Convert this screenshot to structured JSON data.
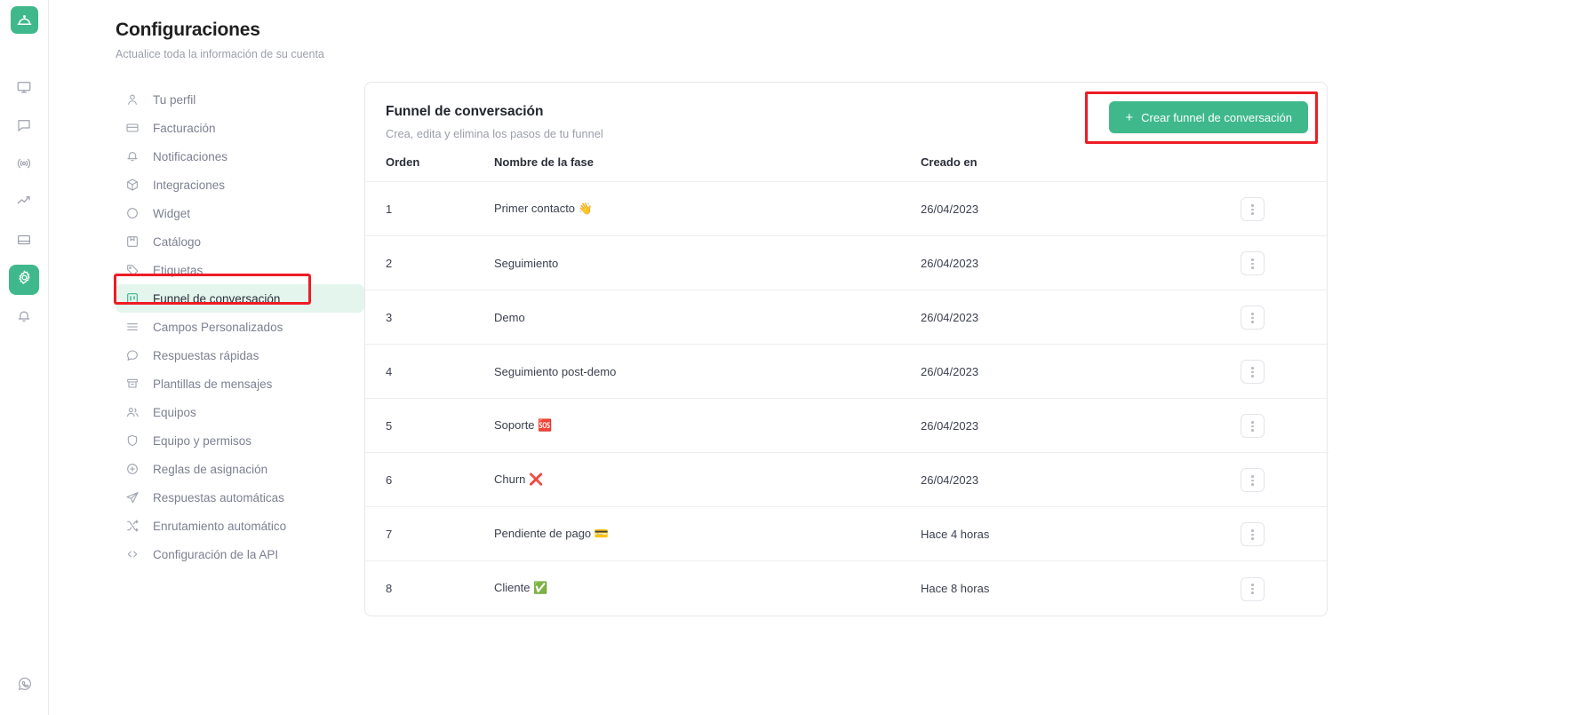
{
  "brand": {
    "accent": "#3fb98c",
    "accent_soft": "#e4f5ee",
    "annotation": "#ee1c25",
    "logo_icon": "cloche-bell-icon"
  },
  "rail": {
    "items": [
      {
        "icon": "monitor-icon",
        "name": "rail-monitor",
        "active": false
      },
      {
        "icon": "chat-bubble-icon",
        "name": "rail-conversations",
        "active": false
      },
      {
        "icon": "broadcast-icon",
        "name": "rail-campaigns",
        "active": false
      },
      {
        "icon": "trending-up-icon",
        "name": "rail-reports",
        "active": false
      },
      {
        "icon": "inbox-icon",
        "name": "rail-inbox",
        "active": false
      },
      {
        "icon": "gear-icon",
        "name": "rail-settings",
        "active": true
      },
      {
        "icon": "bell-icon",
        "name": "rail-notifications",
        "active": false
      }
    ],
    "bottom": {
      "icon": "whatsapp-icon",
      "name": "rail-whatsapp"
    }
  },
  "header": {
    "title": "Configuraciones",
    "subtitle": "Actualice toda la información de su cuenta"
  },
  "settings_nav": {
    "items": [
      {
        "label": "Tu perfil",
        "icon": "user-icon",
        "active": false
      },
      {
        "label": "Facturación",
        "icon": "credit-card-icon",
        "active": false
      },
      {
        "label": "Notificaciones",
        "icon": "bell-icon",
        "active": false
      },
      {
        "label": "Integraciones",
        "icon": "box-icon",
        "active": false
      },
      {
        "label": "Widget",
        "icon": "circle-icon",
        "active": false
      },
      {
        "label": "Catálogo",
        "icon": "catalog-icon",
        "active": false
      },
      {
        "label": "Etiquetas",
        "icon": "tag-icon",
        "active": false
      },
      {
        "label": "Funnel de conversación",
        "icon": "funnel-board-icon",
        "active": true
      },
      {
        "label": "Campos Personalizados",
        "icon": "list-lines-icon",
        "active": false
      },
      {
        "label": "Respuestas rápidas",
        "icon": "speech-bubble-icon",
        "active": false
      },
      {
        "label": "Plantillas de mensajes",
        "icon": "template-icon",
        "active": false
      },
      {
        "label": "Equipos",
        "icon": "users-icon",
        "active": false
      },
      {
        "label": "Equipo y permisos",
        "icon": "shield-icon",
        "active": false
      },
      {
        "label": "Reglas de asignación",
        "icon": "plus-circle-icon",
        "active": false
      },
      {
        "label": "Respuestas automáticas",
        "icon": "paper-plane-icon",
        "active": false
      },
      {
        "label": "Enrutamiento automático",
        "icon": "shuffle-icon",
        "active": false
      },
      {
        "label": "Configuración de la API",
        "icon": "code-brackets-icon",
        "active": false
      }
    ]
  },
  "card": {
    "title": "Funnel de conversación",
    "subtitle": "Crea, edita y elimina los pasos de tu funnel",
    "create_button": {
      "label": "Crear funnel de conversación",
      "icon": "plus-icon"
    },
    "columns": [
      "Orden",
      "Nombre de la fase",
      "Creado en",
      ""
    ],
    "rows": [
      {
        "orden": "1",
        "nombre": "Primer contacto",
        "emoji": "👋",
        "creado": "26/04/2023"
      },
      {
        "orden": "2",
        "nombre": "Seguimiento",
        "emoji": "",
        "creado": "26/04/2023"
      },
      {
        "orden": "3",
        "nombre": "Demo",
        "emoji": "",
        "creado": "26/04/2023"
      },
      {
        "orden": "4",
        "nombre": "Seguimiento post-demo",
        "emoji": "",
        "creado": "26/04/2023"
      },
      {
        "orden": "5",
        "nombre": "Soporte",
        "emoji": "🆘",
        "creado": "26/04/2023"
      },
      {
        "orden": "6",
        "nombre": "Churn",
        "emoji": "❌",
        "creado": "26/04/2023"
      },
      {
        "orden": "7",
        "nombre": "Pendiente de pago",
        "emoji": "💳",
        "creado": "Hace 4 horas"
      },
      {
        "orden": "8",
        "nombre": "Cliente",
        "emoji": "✅",
        "creado": "Hace 8 horas"
      }
    ],
    "row_action_icon": "more-vertical-icon"
  }
}
